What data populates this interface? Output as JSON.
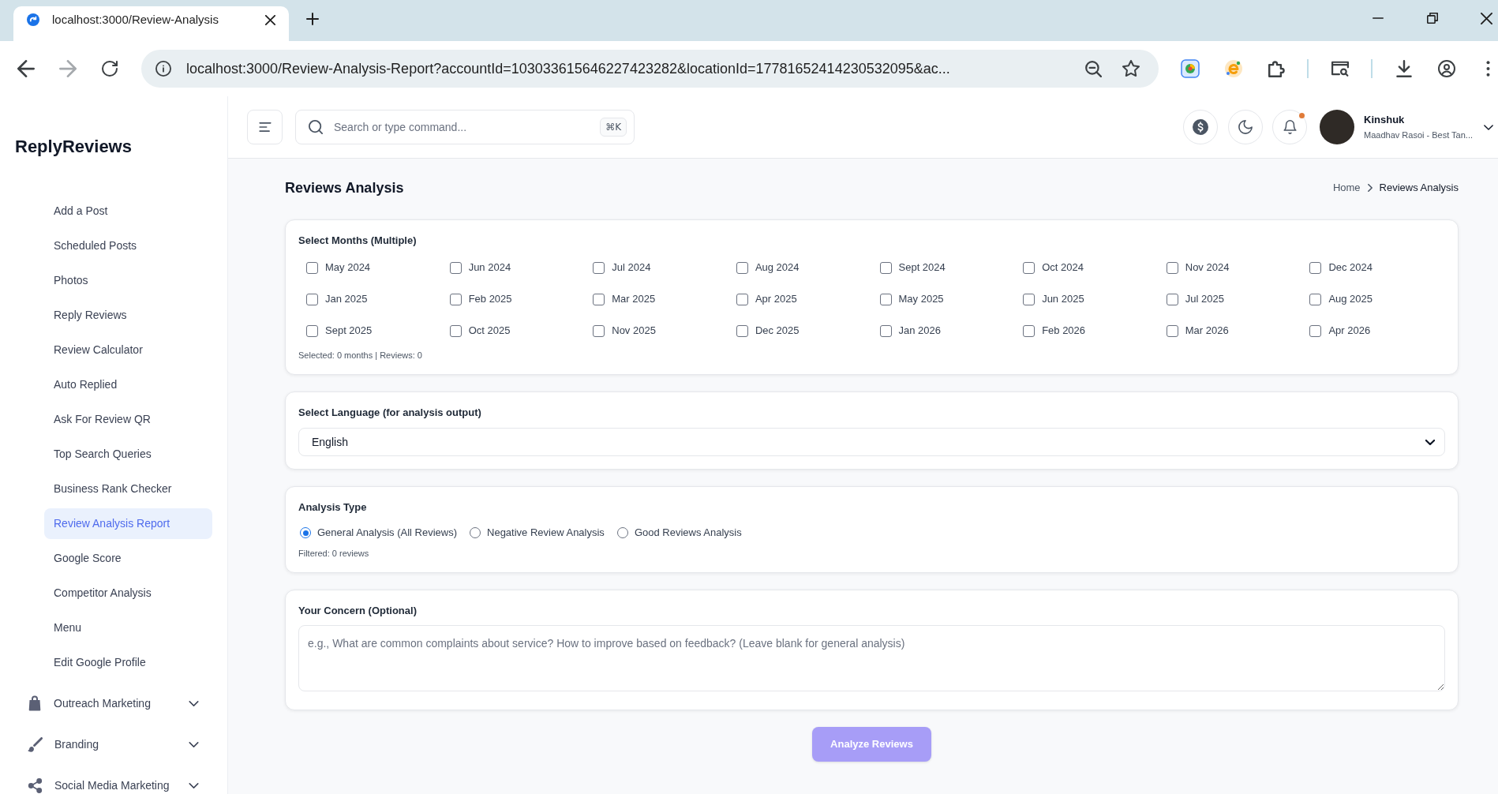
{
  "browser": {
    "tab_title": "localhost:3000/Review-Analysis",
    "url": "localhost:3000/Review-Analysis-Report?accountId=103033615646227423282&locationId=17781652414230532095&ac...",
    "forward": {
      "disabled": true
    }
  },
  "sidebar": {
    "logo": "ReplyReviews",
    "items": [
      {
        "label": "Add a Post",
        "selected": false
      },
      {
        "label": "Scheduled Posts",
        "selected": false
      },
      {
        "label": "Photos",
        "selected": false
      },
      {
        "label": "Reply Reviews",
        "selected": false
      },
      {
        "label": "Review Calculator",
        "selected": false
      },
      {
        "label": "Auto Replied",
        "selected": false
      },
      {
        "label": "Ask For Review QR",
        "selected": false
      },
      {
        "label": "Top Search Queries",
        "selected": false
      },
      {
        "label": "Business Rank Checker",
        "selected": false
      },
      {
        "label": "Review Analysis Report",
        "selected": true
      },
      {
        "label": "Google Score",
        "selected": false
      },
      {
        "label": "Competitor Analysis",
        "selected": false
      },
      {
        "label": "Menu",
        "selected": false
      },
      {
        "label": "Edit Google Profile",
        "selected": false
      }
    ],
    "groups": [
      {
        "label": "Outreach Marketing",
        "expanded": false
      },
      {
        "label": "Branding",
        "expanded": false
      },
      {
        "label": "Social Media Marketing",
        "expanded": false
      }
    ]
  },
  "header": {
    "search": {
      "placeholder": "Search or type command...",
      "shortcut": "⌘K"
    },
    "notifications": {
      "unread": true
    },
    "user": {
      "name": "Kinshuk",
      "subtitle": "Maadhav Rasoi - Best Tan..."
    }
  },
  "page": {
    "title": "Reviews Analysis",
    "breadcrumb": [
      "Home",
      "Reviews Analysis"
    ]
  },
  "months": {
    "label": "Select Months (Multiple)",
    "items": [
      {
        "label": "May 2024",
        "checked": false
      },
      {
        "label": "Jun 2024",
        "checked": false
      },
      {
        "label": "Jul 2024",
        "checked": false
      },
      {
        "label": "Aug 2024",
        "checked": false
      },
      {
        "label": "Sept 2024",
        "checked": false
      },
      {
        "label": "Oct 2024",
        "checked": false
      },
      {
        "label": "Nov 2024",
        "checked": false
      },
      {
        "label": "Dec 2024",
        "checked": false
      },
      {
        "label": "Jan 2025",
        "checked": false
      },
      {
        "label": "Feb 2025",
        "checked": false
      },
      {
        "label": "Mar 2025",
        "checked": false
      },
      {
        "label": "Apr 2025",
        "checked": false
      },
      {
        "label": "May 2025",
        "checked": false
      },
      {
        "label": "Jun 2025",
        "checked": false
      },
      {
        "label": "Jul 2025",
        "checked": false
      },
      {
        "label": "Aug 2025",
        "checked": false
      },
      {
        "label": "Sept 2025",
        "checked": false
      },
      {
        "label": "Oct 2025",
        "checked": false
      },
      {
        "label": "Nov 2025",
        "checked": false
      },
      {
        "label": "Dec 2025",
        "checked": false
      },
      {
        "label": "Jan 2026",
        "checked": false
      },
      {
        "label": "Feb 2026",
        "checked": false
      },
      {
        "label": "Mar 2026",
        "checked": false
      },
      {
        "label": "Apr 2026",
        "checked": false
      }
    ],
    "summary": "Selected: 0 months | Reviews: 0"
  },
  "language": {
    "label": "Select Language (for analysis output)",
    "value": "English"
  },
  "analysis_type": {
    "label": "Analysis Type",
    "options": [
      {
        "label": "General Analysis (All Reviews)",
        "selected": true
      },
      {
        "label": "Negative Review Analysis",
        "selected": false
      },
      {
        "label": "Good Reviews Analysis",
        "selected": false
      }
    ],
    "filtered": "Filtered: 0 reviews"
  },
  "concern": {
    "label": "Your Concern (Optional)",
    "placeholder": "e.g., What are common complaints about service? How to improve based on feedback? (Leave blank for general analysis)"
  },
  "submit": {
    "label": "Analyze Reviews",
    "disabled": true
  }
}
